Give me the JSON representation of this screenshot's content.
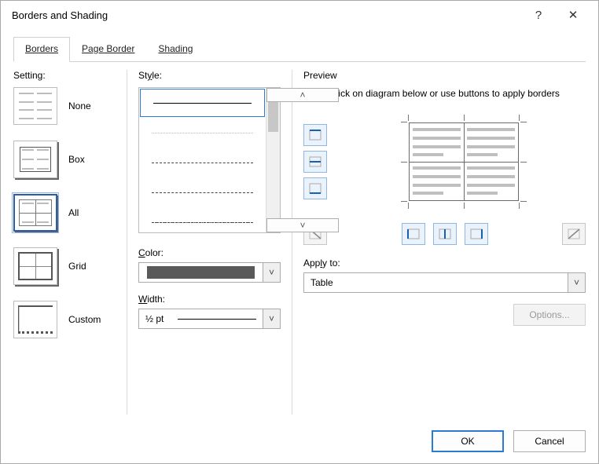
{
  "window": {
    "title": "Borders and Shading",
    "help_tooltip": "?",
    "close_tooltip": "✕"
  },
  "tabs": {
    "borders": "Borders",
    "page_border": "Page Border",
    "shading": "Shading",
    "active": "borders"
  },
  "setting": {
    "label": "Setting:",
    "items": {
      "none": "None",
      "box": "Box",
      "all": "All",
      "grid": "Grid",
      "custom": "Custom"
    },
    "selected": "all"
  },
  "style": {
    "label": "Style:",
    "selected_index": 0,
    "options": [
      "solid",
      "hairline",
      "dashed",
      "long-dash",
      "dash-dot"
    ]
  },
  "color": {
    "label": "Color:",
    "value": "#595959",
    "value_name": "Automatic"
  },
  "width": {
    "label": "Width:",
    "value": "½ pt"
  },
  "preview": {
    "label": "Preview",
    "hint": "Click on diagram below or use buttons to apply borders",
    "side_buttons": {
      "top": true,
      "h_inner": true,
      "bottom": true,
      "diag_down": false,
      "left": true,
      "v_inner": true,
      "right": true,
      "diag_up": false
    },
    "apply_to_label": "Apply to:",
    "apply_to_value": "Table",
    "options_label": "Options...",
    "options_enabled": false
  },
  "footer": {
    "ok": "OK",
    "cancel": "Cancel"
  }
}
